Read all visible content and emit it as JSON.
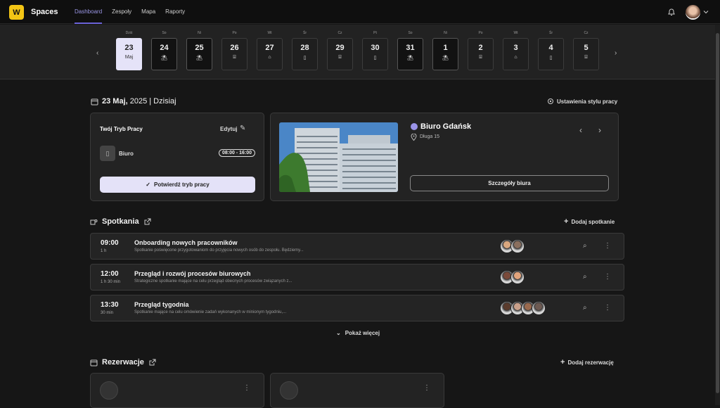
{
  "app": {
    "logo": "W",
    "name": "Spaces"
  },
  "nav": [
    "Dashboard",
    "Zespoły",
    "Mapa",
    "Raporty"
  ],
  "days": [
    {
      "name": "Dziś",
      "num": "23",
      "sub": "Maj",
      "type": "today"
    },
    {
      "name": "So",
      "num": "24",
      "sub": "⛱",
      "type": "dark"
    },
    {
      "name": "Ni",
      "num": "25",
      "sub": "⛱",
      "type": "dark"
    },
    {
      "name": "Po",
      "num": "26",
      "sub": "⌸",
      "type": "light"
    },
    {
      "name": "Wt",
      "num": "27",
      "sub": "⌂",
      "type": "light"
    },
    {
      "name": "Śr",
      "num": "28",
      "sub": "▯",
      "type": "light"
    },
    {
      "name": "Cz",
      "num": "29",
      "sub": "⌸",
      "type": "light"
    },
    {
      "name": "Pt",
      "num": "30",
      "sub": "▯",
      "type": "light"
    },
    {
      "name": "So",
      "num": "31",
      "sub": "⛱",
      "type": "dark"
    },
    {
      "name": "Ni",
      "num": "1",
      "sub": "⛱",
      "type": "dark"
    },
    {
      "name": "Po",
      "num": "2",
      "sub": "⌸",
      "type": "light"
    },
    {
      "name": "Wt",
      "num": "3",
      "sub": "⌂",
      "type": "light"
    },
    {
      "name": "Śr",
      "num": "4",
      "sub": "▯",
      "type": "light"
    },
    {
      "name": "Cz",
      "num": "5",
      "sub": "⌸",
      "type": "light"
    }
  ],
  "date": {
    "day": "23 Maj,",
    "rest": " 2025 | Dzisiaj",
    "settings": "Ustawienia stylu pracy"
  },
  "workmode": {
    "title": "Twój Tryb Pracy",
    "edit": "Edytuj",
    "mode": "Biuro",
    "hours": "08:00 - 16:00",
    "confirm": "Potwierdź tryb pracy"
  },
  "office": {
    "name": "Biuro Gdańsk",
    "address": "Długa 15",
    "details": "Szczegóły biura"
  },
  "meetings": {
    "title": "Spotkania",
    "add": "Dodaj spotkanie",
    "more": "Pokaż więcej",
    "items": [
      {
        "time": "09:00",
        "dur": "1 h",
        "title": "Onboarding nowych pracowników",
        "desc": "Spotkanie poświęcone przygotowaniom do przyjęcia nowych osób do zespołu. Będziemy...",
        "avatars": [
          "#d9a77f",
          "#8a6f5e"
        ]
      },
      {
        "time": "12:00",
        "dur": "1 h 30 min",
        "title": "Przegląd i rozwój procesów biurowych",
        "desc": "Strategiczne spotkanie mające na celu przegląd obecnych procesów związanych z...",
        "avatars": [
          "#7a4a3a",
          "#e0a37c"
        ]
      },
      {
        "time": "13:30",
        "dur": "30 min",
        "title": "Przegląd tygodnia",
        "desc": "Spotkanie mające na celu omówienie zadań wykonanych w minionym tygodniu,...",
        "avatars": [
          "#5a3b2c",
          "#c9a08a",
          "#9a6a4e",
          "#6d5a52"
        ]
      }
    ]
  },
  "reservations": {
    "title": "Rezerwacje",
    "add": "Dodaj rezerwację"
  }
}
